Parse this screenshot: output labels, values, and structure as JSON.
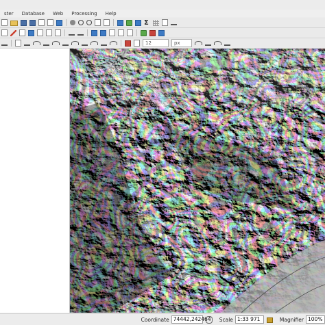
{
  "menu": [
    "ster",
    "Database",
    "Web",
    "Processing",
    "Help"
  ],
  "toolbar3": {
    "font_size_value": "12",
    "unit": "px"
  },
  "status": {
    "coordinate_label": "Coordinate",
    "coordinate_value": "74442,242464",
    "scale_label": "Scale",
    "scale_value": "1:33 971",
    "magnifier_label": "Magnifier",
    "magnifier_value": "100%"
  },
  "icons": {
    "toolbar1": [
      "new-project-icon",
      "open-folder-icon",
      "save-icon",
      "save-as-icon",
      "print-icon",
      "layout-icon",
      "refresh-icon"
    ],
    "toolbar2": [
      "pan-icon",
      "zoom-in-icon",
      "zoom-out-icon",
      "identify-icon",
      "select-icon",
      "measure-icon",
      "sigma-icon",
      "attribute-table-icon"
    ]
  }
}
